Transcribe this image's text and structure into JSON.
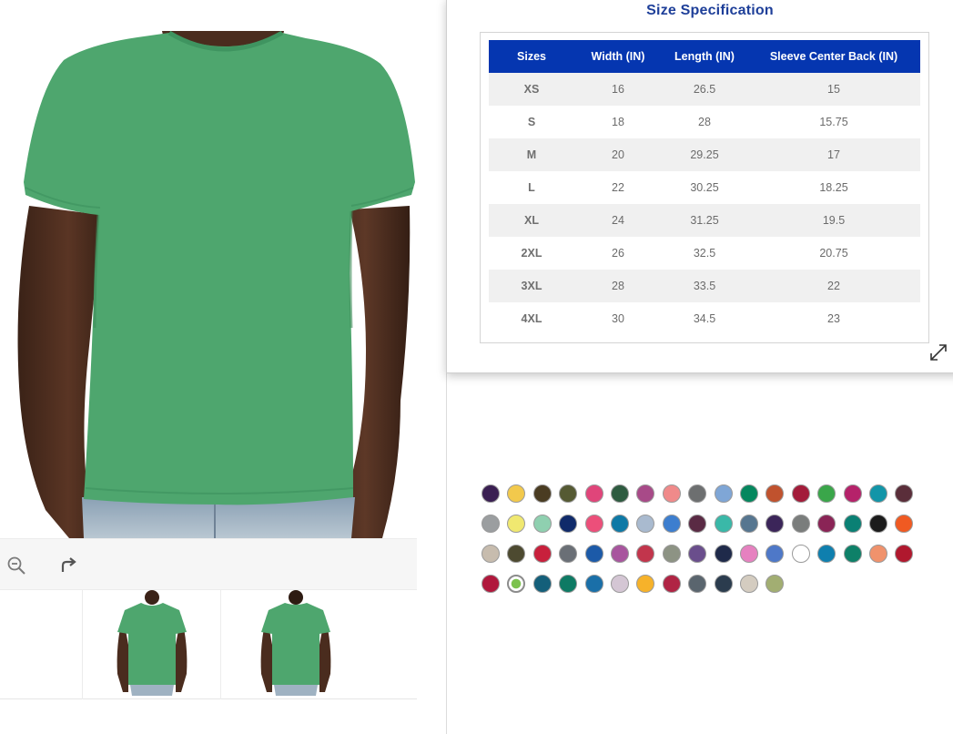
{
  "size_spec": {
    "title": "Size Specification",
    "headers": [
      "Sizes",
      "Width (IN)",
      "Length (IN)",
      "Sleeve Center Back (IN)"
    ],
    "rows": [
      [
        "XS",
        "16",
        "26.5",
        "15"
      ],
      [
        "S",
        "18",
        "28",
        "15.75"
      ],
      [
        "M",
        "20",
        "29.25",
        "17"
      ],
      [
        "L",
        "22",
        "30.25",
        "18.25"
      ],
      [
        "XL",
        "24",
        "31.25",
        "19.5"
      ],
      [
        "2XL",
        "26",
        "32.5",
        "20.75"
      ],
      [
        "3XL",
        "28",
        "33.5",
        "22"
      ],
      [
        "4XL",
        "30",
        "34.5",
        "23"
      ]
    ]
  },
  "viewer": {
    "toolbar": [
      {
        "icon": "zoom-out-icon"
      },
      {
        "icon": "rotate-icon"
      }
    ],
    "shirt_color": "#4ea66e",
    "thumbnails": [
      {
        "view": "front"
      },
      {
        "view": "back"
      }
    ]
  },
  "swatches": {
    "selected_index": 52,
    "colors": [
      "#3a1f52",
      "#f2c94c",
      "#4a3c22",
      "#555a33",
      "#e0457a",
      "#2e5b40",
      "#a84a88",
      "#f08a8a",
      "#6d6f70",
      "#7fa6d6",
      "#05875e",
      "#c0522e",
      "#a31c3a",
      "#3aa64a",
      "#b5226a",
      "#1295a8",
      "#5a2e3a",
      "#9b9ea0",
      "#f0e870",
      "#8fd0b0",
      "#0f2a6a",
      "#ec4f7a",
      "#0e79a6",
      "#a9bacf",
      "#3d7ecf",
      "#5a2a44",
      "#3ab8a8",
      "#567690",
      "#3b2559",
      "#7a7d7c",
      "#8a2456",
      "#0a8074",
      "#1b1b1b",
      "#f05a22",
      "#c7bcae",
      "#4d4a30",
      "#c8203c",
      "#6a6f76",
      "#1c5aa8",
      "#a8559e",
      "#c2354c",
      "#8d9384",
      "#6a4e8c",
      "#1f2a4a",
      "#e681c0",
      "#4e78c8",
      "#ffffff",
      "#0f7fae",
      "#0e8068",
      "#f0926c",
      "#b0182e",
      "#b0183c",
      "#7cc24e",
      "#145f7a",
      "#0e7a64",
      "#1a6fa8",
      "#d4c6d4",
      "#f6b22a",
      "#b02444",
      "#5a656e",
      "#2b3c4e",
      "#d4ccc0",
      "#a2ae72"
    ]
  }
}
